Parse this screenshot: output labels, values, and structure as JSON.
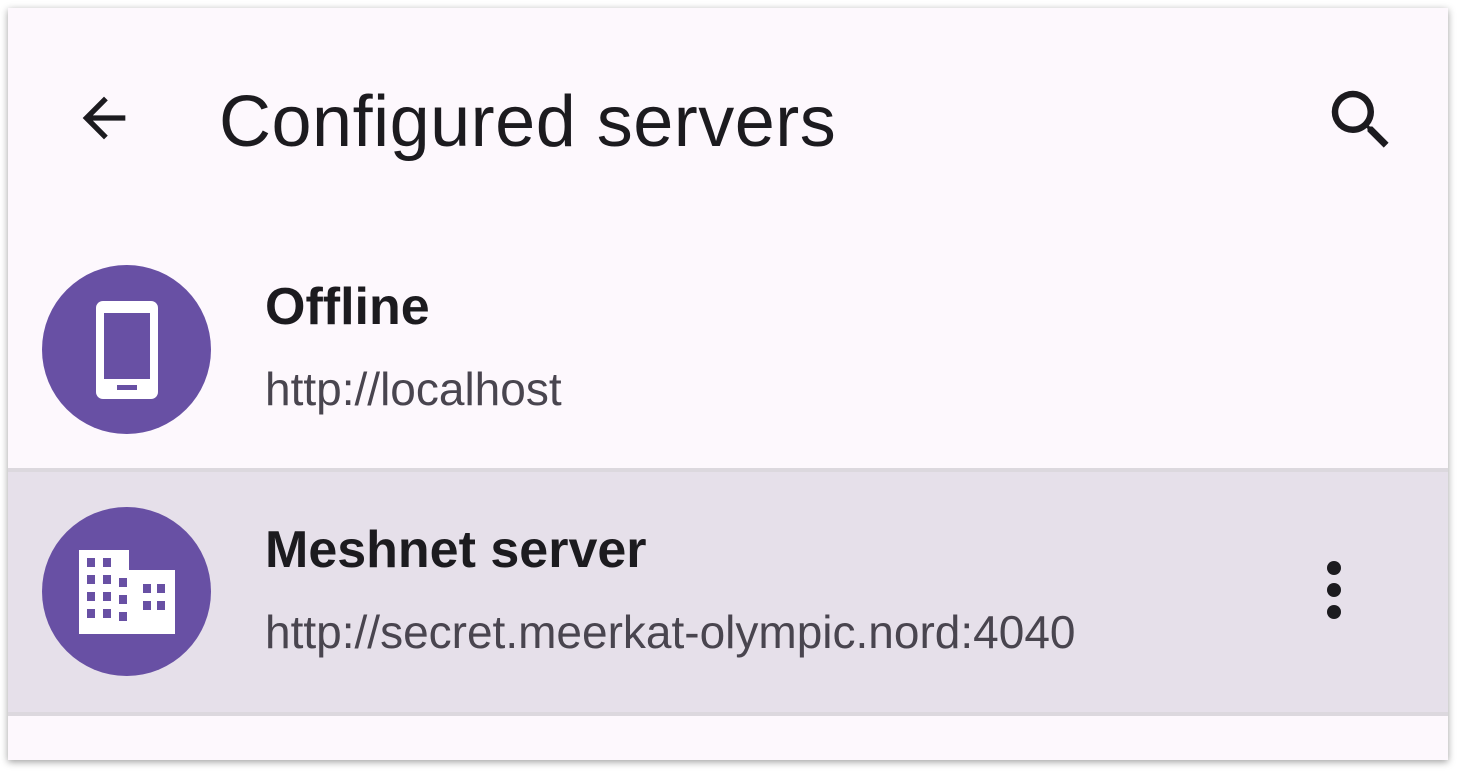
{
  "app_bar": {
    "title": "Configured servers",
    "back_icon": "arrow-back-icon",
    "search_icon": "search-icon"
  },
  "servers": [
    {
      "name": "Offline",
      "url": "http://localhost",
      "icon": "smartphone-icon",
      "selected": false
    },
    {
      "name": "Meshnet server",
      "url": "http://secret.meerkat-olympic.nord:4040",
      "icon": "building-icon",
      "selected": true,
      "menu_icon": "more-vert-icon"
    }
  ],
  "colors": {
    "background": "#fdf8fd",
    "avatar": "#6850a4",
    "selected_row": "#e6e0ea",
    "primary_text": "#1c1b1f",
    "secondary_text": "#49454f"
  }
}
